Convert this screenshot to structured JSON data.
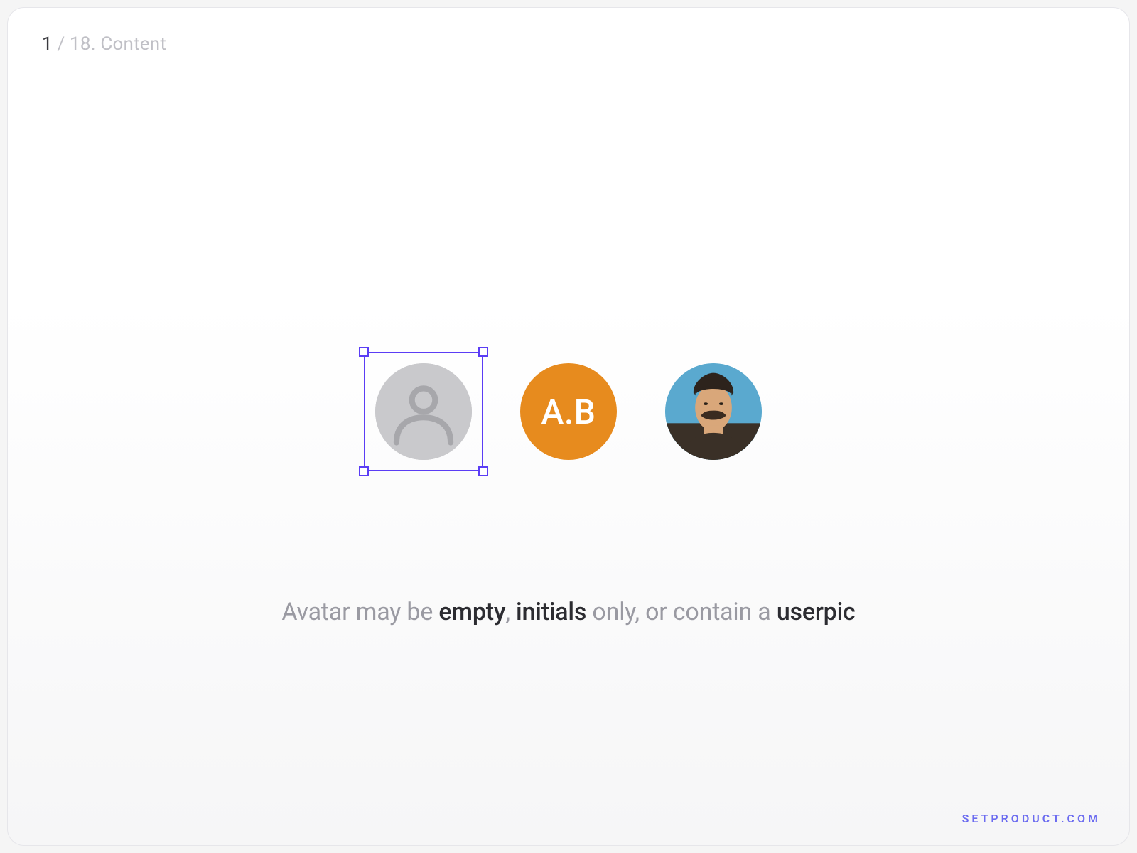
{
  "breadcrumb": {
    "current": "1",
    "separator": " / ",
    "total": "18. Content"
  },
  "avatars": {
    "initials_text": "A.B",
    "initials_bg": "#e78b1e",
    "selection_color": "#5b3df5"
  },
  "caption": {
    "t1": "Avatar may be ",
    "s1": "empty",
    "t2": ", ",
    "s2": "initials",
    "t3": " only, or contain a ",
    "s3": "userpic"
  },
  "watermark": "SETPRODUCT.COM"
}
